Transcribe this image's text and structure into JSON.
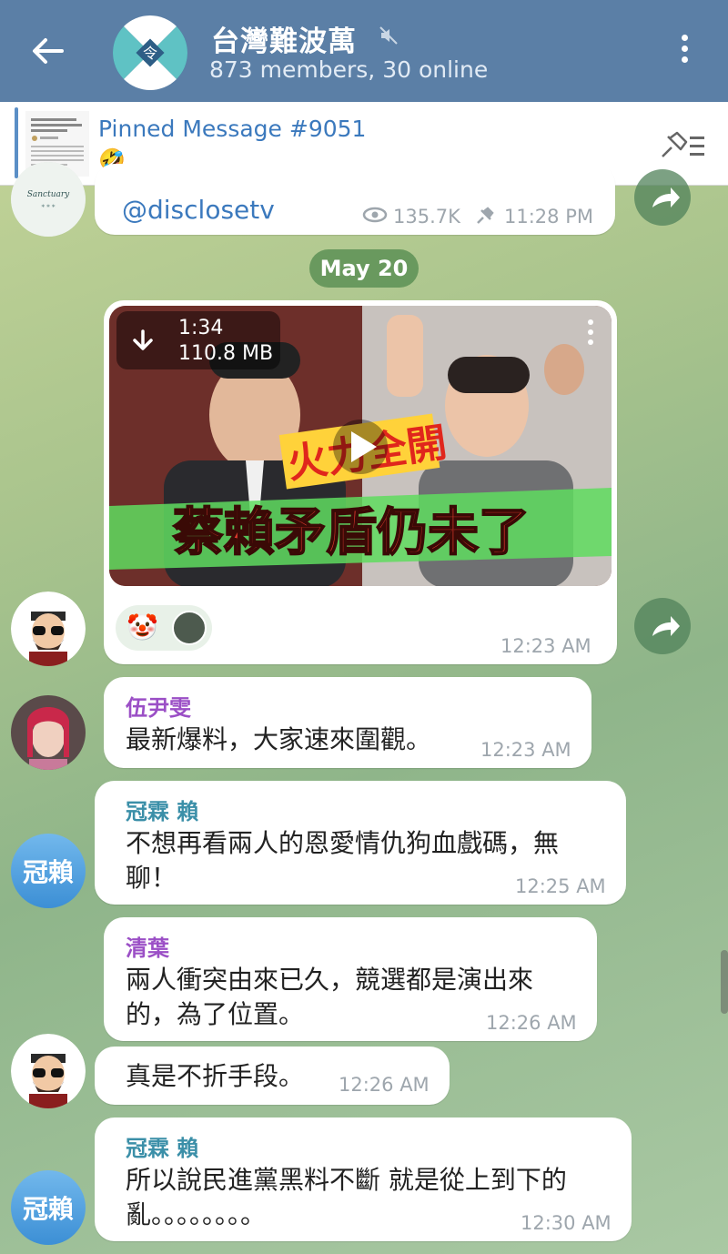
{
  "header": {
    "title": "台灣難波萬",
    "subtitle": "873 members, 30 online"
  },
  "pinned": {
    "title": "Pinned Message #9051",
    "preview": "🤣"
  },
  "messages": {
    "m0": {
      "text": "@disclosetv",
      "views": "135.7K",
      "time": "11:28 PM"
    },
    "date_separator": "May 20",
    "video": {
      "duration": "1:34",
      "size": "110.8 MB",
      "caption": "蔡賴矛盾仍未了",
      "time": "12:23 AM",
      "reaction_emoji": "🤡"
    },
    "m1": {
      "sender": "伍尹雯",
      "text": "最新爆料，大家速來圍觀。",
      "time": "12:23 AM"
    },
    "m2": {
      "sender": "冠霖 賴",
      "avatar_text": "冠賴",
      "line1": "不想再看兩人的恩愛情仇狗血戲碼，無",
      "line2": "聊！",
      "time": "12:25 AM"
    },
    "m3": {
      "sender": "清葉",
      "line1": "兩人衝突由來已久，競選都是演出來",
      "line2": "的，為了位置。",
      "time": "12:26 AM"
    },
    "m4": {
      "text": "真是不折手段。",
      "time": "12:26 AM"
    },
    "m5": {
      "sender": "冠霖 賴",
      "avatar_text": "冠賴",
      "line1": "所以說民進黨黑料不斷 就是從上到下的",
      "line2": "亂。。。。。。。。",
      "time": "12:30 AM"
    }
  },
  "colors": {
    "header_bg": "#5b7fa6",
    "name_purple": "#9b4fc6",
    "name_teal": "#3b8fa8",
    "accent_blue": "#3b79bd"
  },
  "icons": [
    "back-arrow-icon",
    "mute-icon",
    "more-vert-icon",
    "pin-list-icon",
    "eye-icon",
    "pin-icon",
    "forward-icon",
    "download-icon",
    "play-icon"
  ]
}
